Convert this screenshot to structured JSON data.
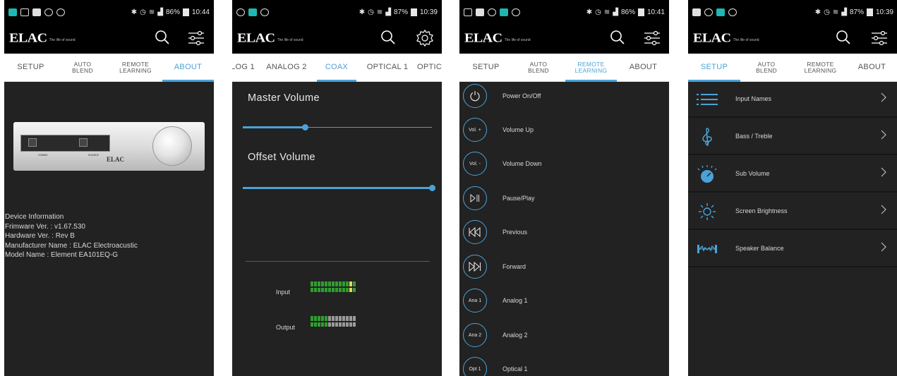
{
  "brand": {
    "logo": "ELAC",
    "tagline": "The life of sound"
  },
  "colors": {
    "accent": "#4aa3d8",
    "panel_bg": "#222222",
    "meter_green": "#2f9e2f",
    "meter_yellow": "#e8d84a",
    "meter_gray": "#9a9a9a"
  },
  "panels": [
    {
      "status": {
        "battery": "86%",
        "time": "10:44"
      },
      "tabs": [
        {
          "label": "SETUP"
        },
        {
          "label": "AUTO BLEND"
        },
        {
          "label": "REMOTE LEARNING"
        },
        {
          "label": "ABOUT"
        }
      ],
      "device": {
        "brand": "ELAC",
        "display_label_1": "COMMS",
        "display_label_2": "SOURCE"
      },
      "info": {
        "heading": "Device Information",
        "firmware": "Frimware Ver. : v1.67.530",
        "hardware": "Hardware Ver. : Rev B",
        "manufacturer": "Manufacturer Name : ELAC Electroacustic",
        "model": "Model Name : Element EA101EQ-G"
      }
    },
    {
      "status": {
        "battery": "87%",
        "time": "10:39"
      },
      "tabs": [
        {
          "label": "LOG 1"
        },
        {
          "label": "ANALOG 2"
        },
        {
          "label": "COAX"
        },
        {
          "label": "OPTICAL 1"
        },
        {
          "label": "OPTIC"
        }
      ],
      "master_volume": {
        "label": "Master Volume",
        "level": 0.33
      },
      "offset_volume": {
        "label": "Offset Volume",
        "level": 1.0
      },
      "meters": {
        "input_label": "Input",
        "output_label": "Output",
        "input": [
          "g",
          "g",
          "g",
          "g",
          "g",
          "g",
          "g",
          "g",
          "g",
          "g",
          "g",
          "y",
          "g"
        ],
        "output": [
          "g",
          "g",
          "g",
          "g",
          "g",
          "x",
          "x",
          "x",
          "x",
          "x",
          "x",
          "x",
          "x"
        ]
      }
    },
    {
      "status": {
        "battery": "86%",
        "time": "10:41"
      },
      "tabs": [
        {
          "label": "SETUP"
        },
        {
          "label": "AUTO BLEND"
        },
        {
          "label": "REMOTE LEARNING"
        },
        {
          "label": "ABOUT"
        }
      ],
      "commands": [
        {
          "icon": "power-icon",
          "circle": "",
          "label": "Power On/Off"
        },
        {
          "icon": "",
          "circle": "Vol. +",
          "label": "Volume Up"
        },
        {
          "icon": "",
          "circle": "Vol. -",
          "label": "Volume Down"
        },
        {
          "icon": "play-pause-icon",
          "circle": "",
          "label": "Pause/Play"
        },
        {
          "icon": "previous-icon",
          "circle": "",
          "label": "Previous"
        },
        {
          "icon": "forward-icon",
          "circle": "",
          "label": "Forward"
        },
        {
          "icon": "",
          "circle": "Ana 1",
          "label": "Analog 1"
        },
        {
          "icon": "",
          "circle": "Ana 2",
          "label": "Analog 2"
        },
        {
          "icon": "",
          "circle": "Opt 1",
          "label": "Optical 1"
        }
      ]
    },
    {
      "status": {
        "battery": "87%",
        "time": "10:39"
      },
      "tabs": [
        {
          "label": "SETUP"
        },
        {
          "label": "AUTO BLEND"
        },
        {
          "label": "REMOTE LEARNING"
        },
        {
          "label": "ABOUT"
        }
      ],
      "settings": [
        {
          "icon": "list-icon",
          "label": "Input Names"
        },
        {
          "icon": "treble-clef-icon",
          "label": "Bass / Treble"
        },
        {
          "icon": "dial-icon",
          "label": "Sub Volume"
        },
        {
          "icon": "sun-icon",
          "label": "Screen Brightness"
        },
        {
          "icon": "speaker-balance-icon",
          "label": "Speaker Balance"
        }
      ]
    }
  ]
}
